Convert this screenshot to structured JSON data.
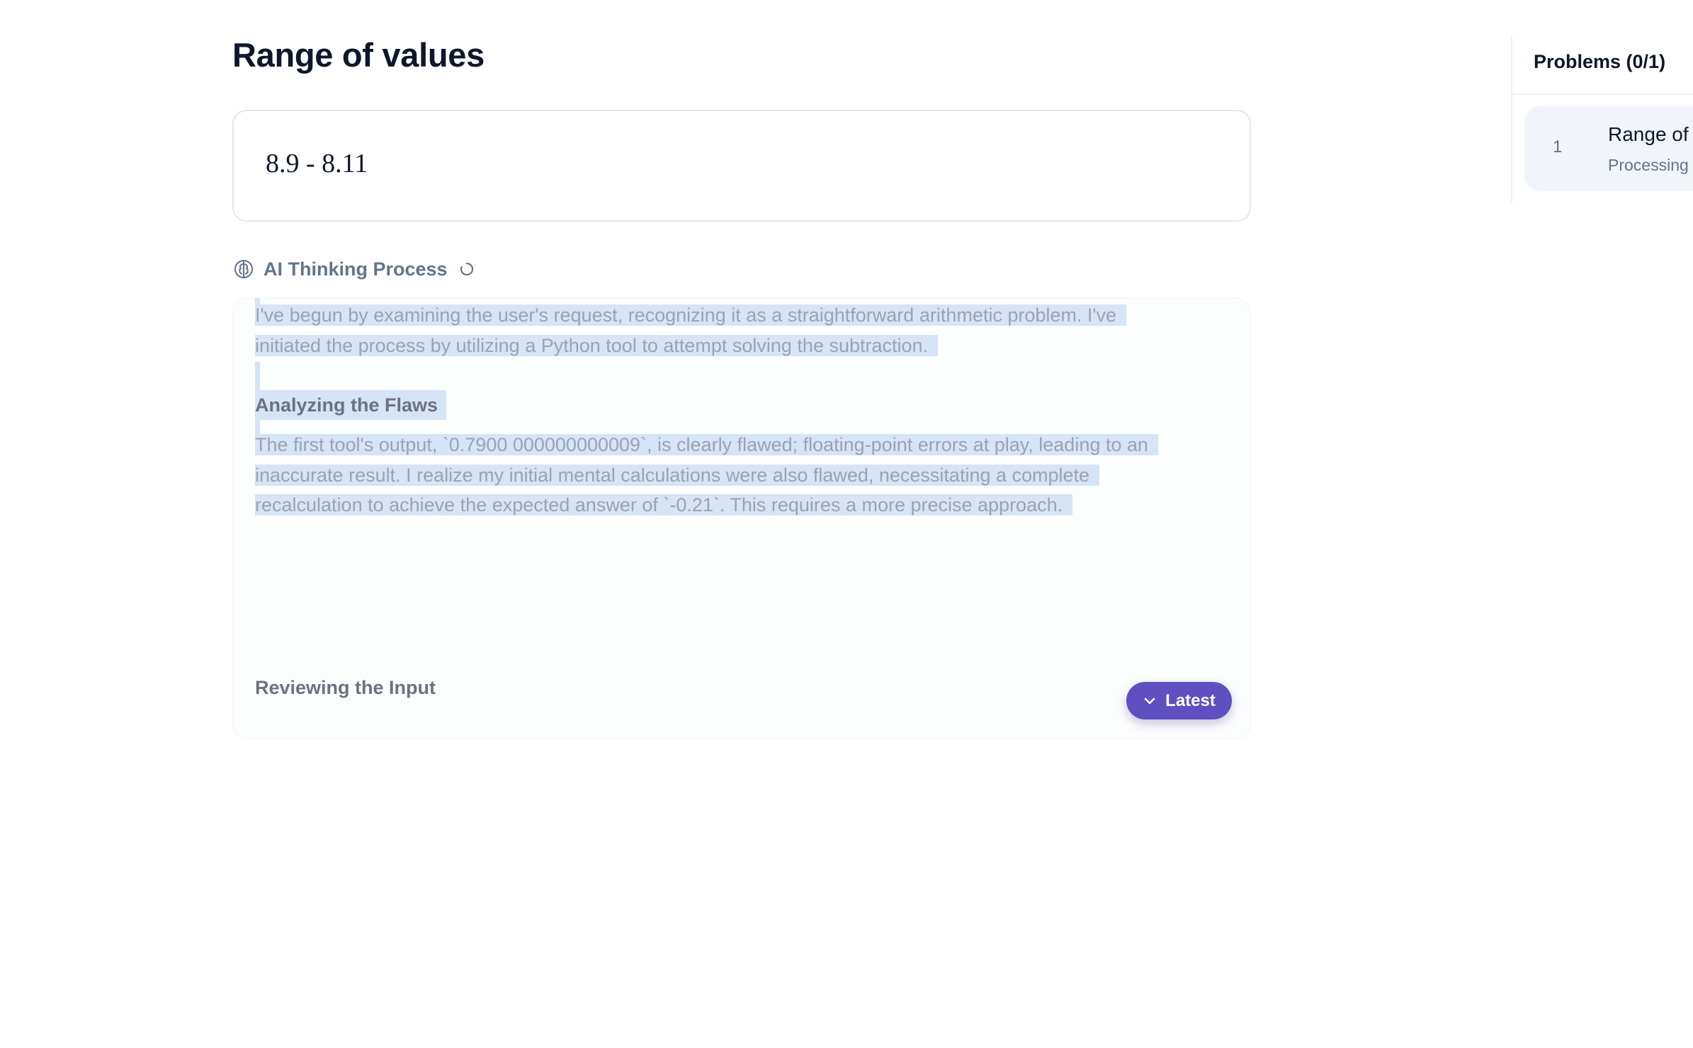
{
  "problem": {
    "title": "Range of values",
    "expression": "8.9 - 8.11"
  },
  "thinking": {
    "label": "AI Thinking Process",
    "icon": "brain-icon",
    "status_icon": "loading-spinner-icon",
    "paragraph_1": [
      "I've begun by examining the user's request, recognizing it as a straightforward arithmetic problem. I've",
      "initiated the process by utilizing a Python tool to attempt solving the subtraction."
    ],
    "heading_1": "Analyzing the Flaws",
    "paragraph_2": [
      "The first tool's output, `0.7900 000000000009`, is clearly flawed; floating-point errors at play, leading to an",
      "inaccurate result. I realize my initial mental calculations were also flawed, necessitating a complete",
      "recalculation to achieve the expected answer of `-0.21`. This requires a more precise approach."
    ],
    "heading_2": "Reviewing the Input",
    "latest_button": "Latest"
  },
  "sidebar": {
    "title": "Problems (0/1)",
    "items": [
      {
        "number": "1",
        "title": "Range of",
        "status": "Processing"
      }
    ]
  },
  "colors": {
    "accent": "#5f4fc0",
    "selection": "#d6e4f7",
    "muted_text": "#9ca3af",
    "heading_text": "#0f172a"
  }
}
